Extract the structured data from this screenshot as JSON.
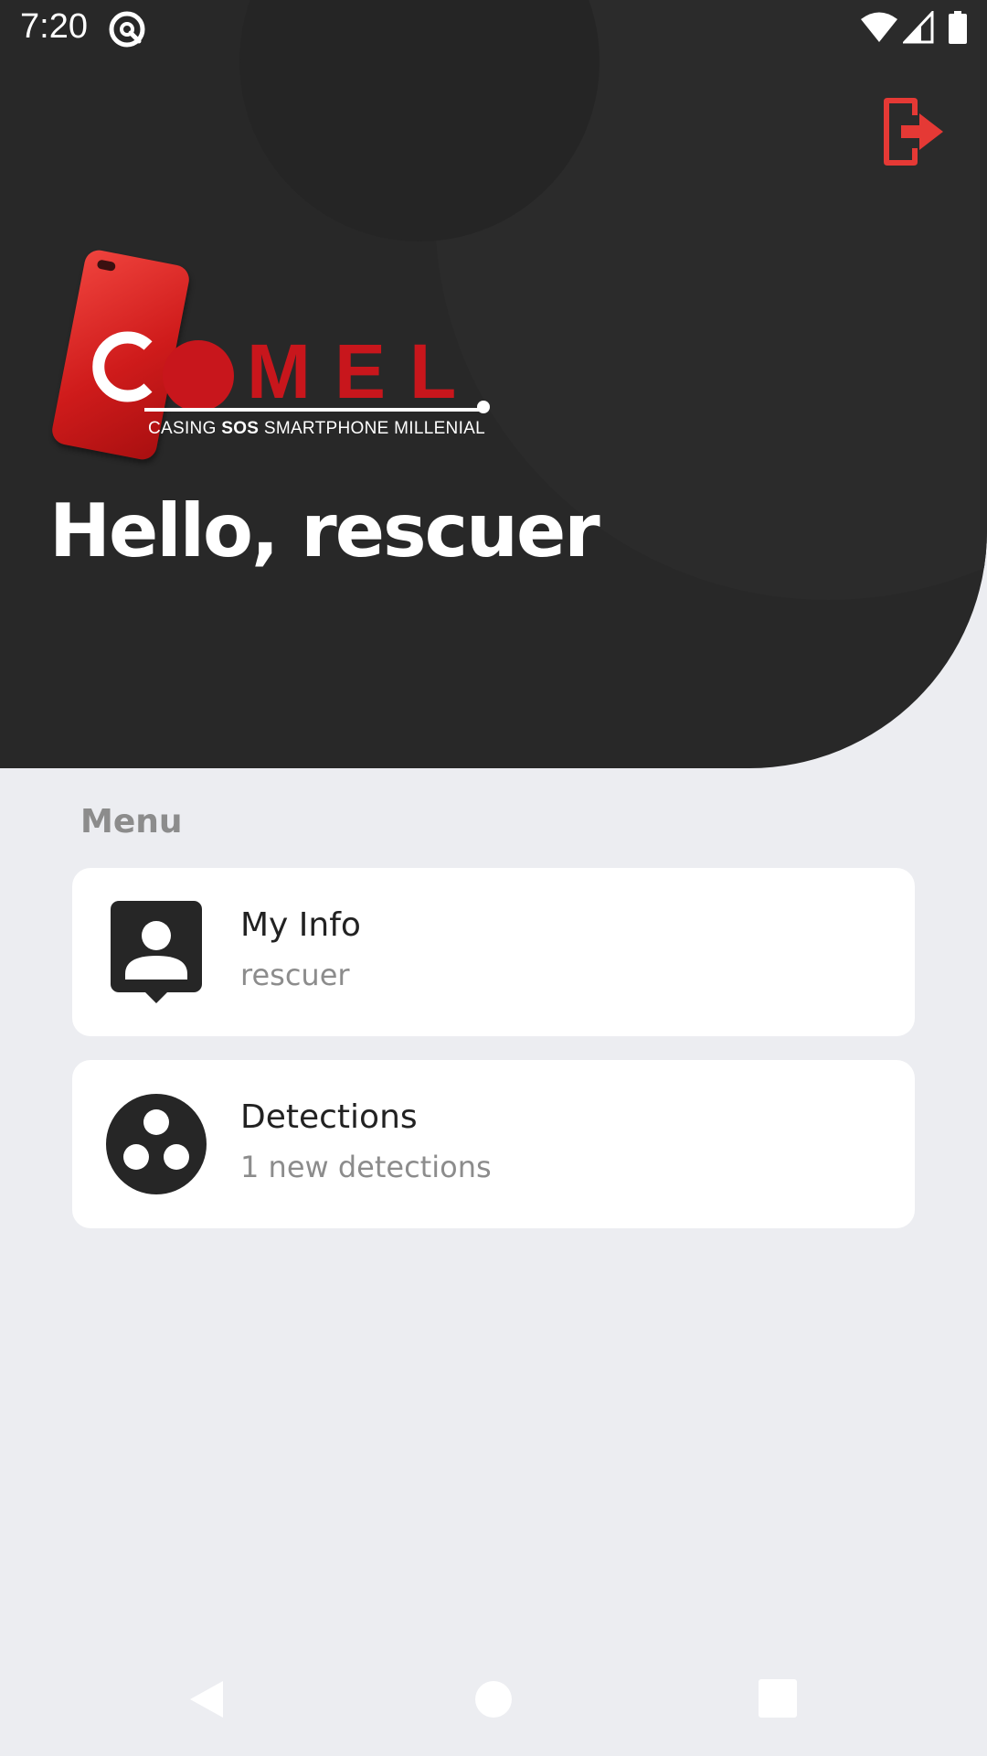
{
  "status_bar": {
    "time": "7:20",
    "icons": [
      "app-notification-icon",
      "wifi-icon",
      "cell-signal-icon",
      "battery-icon"
    ]
  },
  "header": {
    "logout_icon": "logout-icon",
    "greeting": "Hello, rescuer",
    "logo": {
      "brand": "COMEL",
      "tagline_pre": "CASING ",
      "tagline_bold": "SOS",
      "tagline_post": " SMARTPHONE MILLENIAL"
    }
  },
  "menu": {
    "title": "Menu",
    "items": [
      {
        "title": "My Info",
        "subtitle": "rescuer",
        "icon": "user-badge-icon"
      },
      {
        "title": "Detections",
        "subtitle": "1 new detections",
        "icon": "detections-dots-icon"
      }
    ]
  },
  "nav_bar": {
    "icons": [
      "back-icon",
      "home-icon",
      "recents-icon"
    ]
  },
  "colors": {
    "header_bg": "#282828",
    "accent_red": "#e53935",
    "brand_red": "#c8161c",
    "page_bg": "#ecedf1",
    "card_bg": "#ffffff",
    "muted_text": "#8c8c8c"
  }
}
